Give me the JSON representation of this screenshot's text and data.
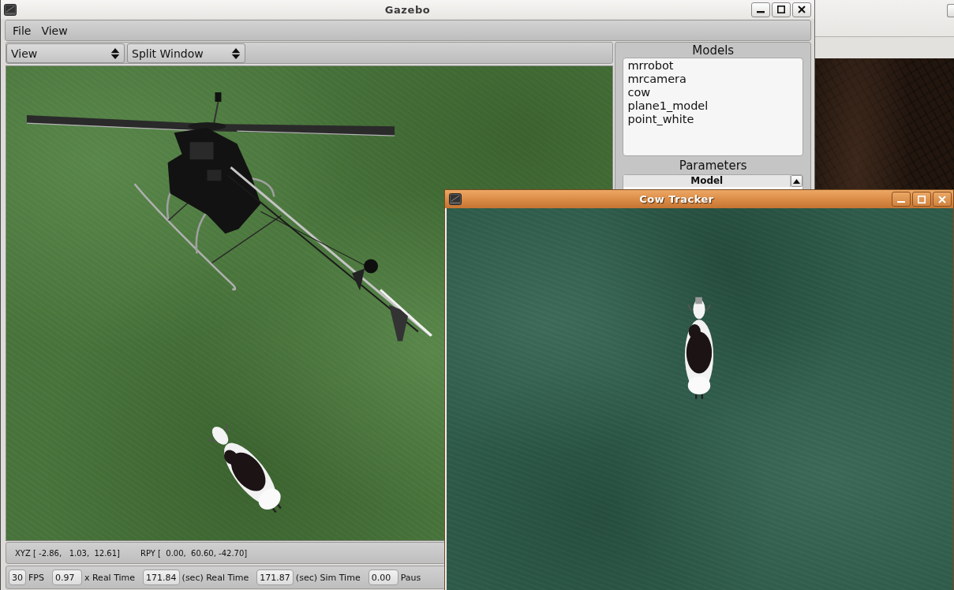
{
  "gazebo_window": {
    "title": "Gazebo"
  },
  "menu_bar": [
    {
      "label": "File"
    },
    {
      "label": "View"
    }
  ],
  "toolbar": {
    "dropdowns": [
      {
        "value": "View"
      },
      {
        "value": "Split Window"
      }
    ]
  },
  "models_panel": {
    "title": "Models",
    "items": [
      {
        "label": "mrrobot",
        "selected": false
      },
      {
        "label": "mrcamera",
        "selected": false
      },
      {
        "label": "cow",
        "selected": false
      },
      {
        "label": "plane1_model",
        "selected": false
      },
      {
        "label": "point_white",
        "selected": false
      }
    ]
  },
  "parameters_panel": {
    "title": "Parameters",
    "table": {
      "columns": [
        "Model"
      ]
    }
  },
  "pose_bar": {
    "xyz": "XYZ [ -2.86,   1.03,  12.61]",
    "rpy": "RPY [  0.00,  60.60, -42.70]"
  },
  "time_bar": [
    {
      "reading": "30",
      "caption": "FPS"
    },
    {
      "reading": "0.97",
      "caption": "x Real Time"
    },
    {
      "reading": "171.84",
      "caption": "(sec) Real Time"
    },
    {
      "reading": "171.87",
      "caption": "(sec) Sim Time"
    },
    {
      "reading": "0.00",
      "caption": "Paus"
    }
  ],
  "cow_tracker_window": {
    "title": "Cow Tracker"
  }
}
